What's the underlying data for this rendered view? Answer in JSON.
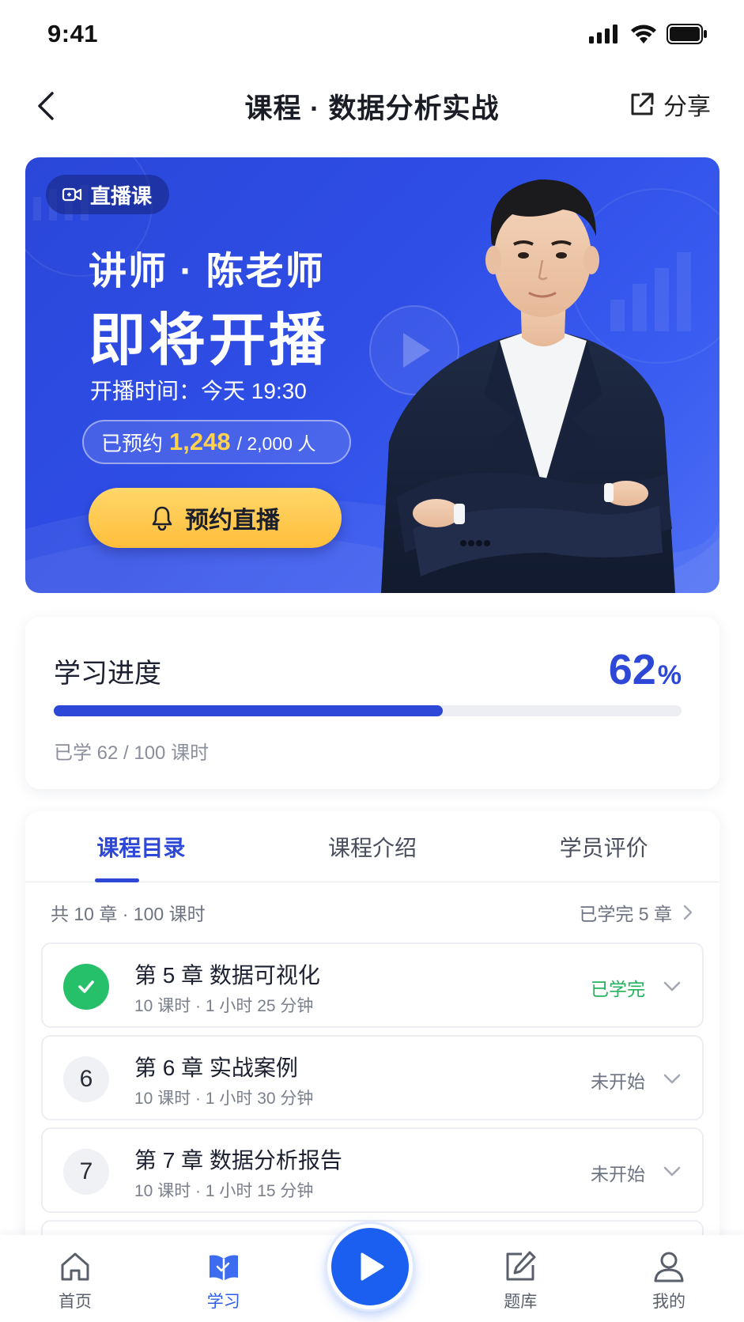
{
  "status_bar": {
    "time": "9:41"
  },
  "nav": {
    "title": "课程 · 数据分析实战",
    "share_label": "分享"
  },
  "hero": {
    "tag_label": "直播课",
    "instructor": "讲师 · 陈老师",
    "headline": "即将开播",
    "time_label": "开播时间：",
    "time_value": "今天 19:30",
    "reserved_label": "已预约",
    "reserved_count": "1,248",
    "reserved_total": "/ 2,000 人",
    "cta_label": "预约直播"
  },
  "progress": {
    "title": "学习进度",
    "value": "62",
    "unit": "%",
    "fraction": 0.62,
    "note": "已学 62 / 100 课时"
  },
  "catalog": {
    "tabs": [
      {
        "label": "课程目录",
        "active": true
      },
      {
        "label": "课程介绍",
        "active": false
      },
      {
        "label": "学员评价",
        "active": false
      }
    ],
    "summary_left": "共 10 章 · 100 课时",
    "summary_right": "已学完 5 章",
    "chapters": [
      {
        "badge": "",
        "title": "第 5 章  数据可视化",
        "meta": "10 课时 · 1 小时 25 分钟",
        "status": "已学完",
        "done": true
      },
      {
        "badge": "6",
        "title": "第 6 章  实战案例",
        "meta": "10 课时 · 1 小时 30 分钟",
        "status": "未开始",
        "done": false
      },
      {
        "badge": "7",
        "title": "第 7 章  数据分析报告",
        "meta": "10 课时 · 1 小时 15 分钟",
        "status": "未开始",
        "done": false
      }
    ]
  },
  "tab_bar": {
    "items": [
      {
        "label": "首页",
        "icon": "home-icon"
      },
      {
        "label": "学习",
        "icon": "book-icon",
        "active": true
      },
      {
        "label": "题库",
        "icon": "edit-icon"
      },
      {
        "label": "我的",
        "icon": "user-icon"
      }
    ]
  },
  "colors": {
    "accent": "#2d47d6",
    "cta": "#ffc24a",
    "done": "#27c06a",
    "play": "#1a5ff0"
  }
}
